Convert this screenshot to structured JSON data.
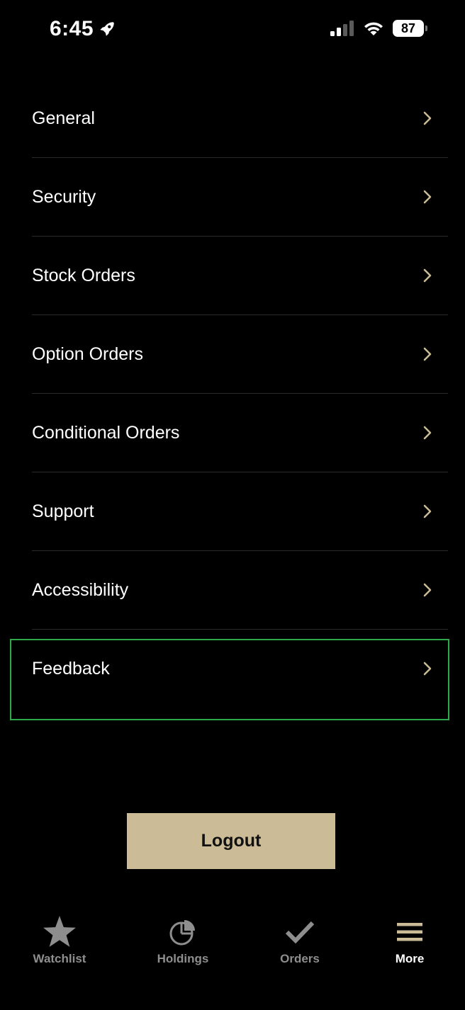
{
  "status_bar": {
    "time": "6:45",
    "battery": "87"
  },
  "menu": {
    "items": [
      {
        "label": "General"
      },
      {
        "label": "Security"
      },
      {
        "label": "Stock Orders"
      },
      {
        "label": "Option Orders"
      },
      {
        "label": "Conditional Orders"
      },
      {
        "label": "Support"
      },
      {
        "label": "Accessibility"
      },
      {
        "label": "Feedback"
      }
    ]
  },
  "logout": {
    "label": "Logout"
  },
  "tab_bar": {
    "tabs": [
      {
        "label": "Watchlist",
        "icon": "star-icon"
      },
      {
        "label": "Holdings",
        "icon": "pie-chart-icon"
      },
      {
        "label": "Orders",
        "icon": "checkmark-icon"
      },
      {
        "label": "More",
        "icon": "hamburger-menu-icon"
      }
    ],
    "active": "More"
  },
  "colors": {
    "background": "#000000",
    "accent": "#cbbb97",
    "highlight_border": "#2fa84a",
    "inactive_tab": "#8e8e8e"
  }
}
